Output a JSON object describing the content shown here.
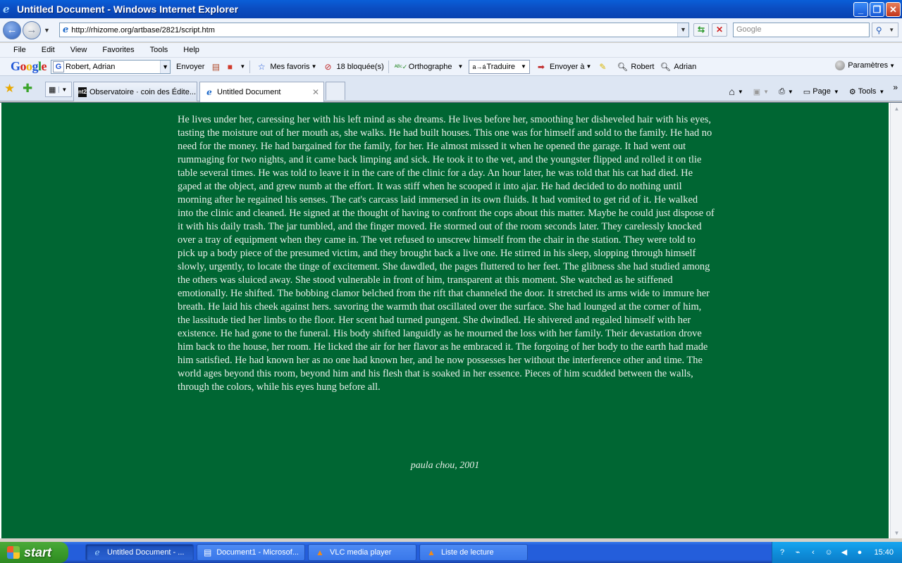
{
  "window": {
    "title": "Untitled Document - Windows Internet Explorer"
  },
  "address": {
    "url": "http://rhizome.org/artbase/2821/script.htm",
    "search_placeholder": "Google"
  },
  "menu": [
    "File",
    "Edit",
    "View",
    "Favorites",
    "Tools",
    "Help"
  ],
  "google_toolbar": {
    "search_value": "Robert, Adrian",
    "send_label": "Envoyer",
    "favorites_label": "Mes favoris",
    "blocked_label": "18 bloquée(s)",
    "spell_label": "Orthographe",
    "translate_label": "Traduire",
    "send_to_label": "Envoyer à",
    "robert_label": "Robert",
    "adrian_label": "Adrian",
    "settings_label": "Paramètres"
  },
  "tabs": [
    {
      "title": "Observatoire · coin des Édite...",
      "favicon_text": "nt2",
      "active": false
    },
    {
      "title": "Untitled Document",
      "favicon_text": "e",
      "active": true
    }
  ],
  "command_bar": {
    "page_label": "Page",
    "tools_label": "Tools"
  },
  "content": {
    "background": "#006633",
    "story": "He lives under her, caressing her with his left mind as she dreams. He lives before her, smoothing her disheveled hair with his eyes, tasting the moisture out of her mouth as, she walks. He had built houses. This one was for himself and sold to the family. He had no need for the money. He had bargained for the family, for her. He almost missed it when he opened the garage. It had went out rummaging for two nights, and it came back limping and sick. He took it to the vet, and the youngster flipped and rolled it on tlie table several times. He was told to leave it in the care of the clinic for a day. An hour later, he was told that his cat had died. He gaped at the object, and grew numb at the effort. It was stiff when he scooped it into ajar. He had decided to do nothing until morning after he regained his senses. The cat's carcass laid immersed in its own fluids. It had vomited to get rid of it. He walked into the clinic and cleaned. He signed at the thought of having to confront the cops about this matter. Maybe he could just dispose of it with his daily trash. The jar tumbled, and the finger moved. He stormed out of the room seconds later. They carelessly knocked over a tray of equipment when they came in. The vet refused to unscrew himself from the chair in the station. They were told to pick up a body piece of the presumed victim, and they brought back a live one. He stirred in his sleep, slopping through himself slowly, urgently, to locate the tinge of excitement. She dawdled, the pages fluttered to her feet. The glibness she had studied among the others was sluiced away. She stood vulnerable in front of him, transparent at this moment. She watched as he stiffened emotionally. He shifted. The bobbing clamor belched from the rift that channeled the door. It stretched its arms wide to immure her breath. He laid his cheek against hers. savoring the warmth that oscillated over the surface. She had lounged at the corner of him, the lassitude tied her limbs to the floor. Her scent had turned pungent. She dwindled. He shivered and regaled himself with her existence. He had gone to the funeral. His body shifted languidly as he mourned the loss with her family. Their devastation drove him back to the house, her room. He licked the air for her flavor as he embraced it. The forgoing of her body to the earth had made him satisfied. He had known her as no one had known her, and he now possesses her without the interference other and time. The world ages beyond this room, beyond him and his flesh that is soaked in her essence. Pieces of him scudded between the walls, through the colors, while his eyes hung before all.",
    "signature": "paula chou, 2001"
  },
  "taskbar": {
    "start_label": "start",
    "tasks": [
      {
        "label": "Untitled Document - ...",
        "icon": "ie-icon",
        "active": true
      },
      {
        "label": "Document1 - Microsof...",
        "icon": "word-icon",
        "active": false
      },
      {
        "label": "VLC media player",
        "icon": "vlc-icon",
        "active": false
      },
      {
        "label": "Liste de lecture",
        "icon": "vlc-icon",
        "active": false
      }
    ],
    "clock": "15:40"
  }
}
